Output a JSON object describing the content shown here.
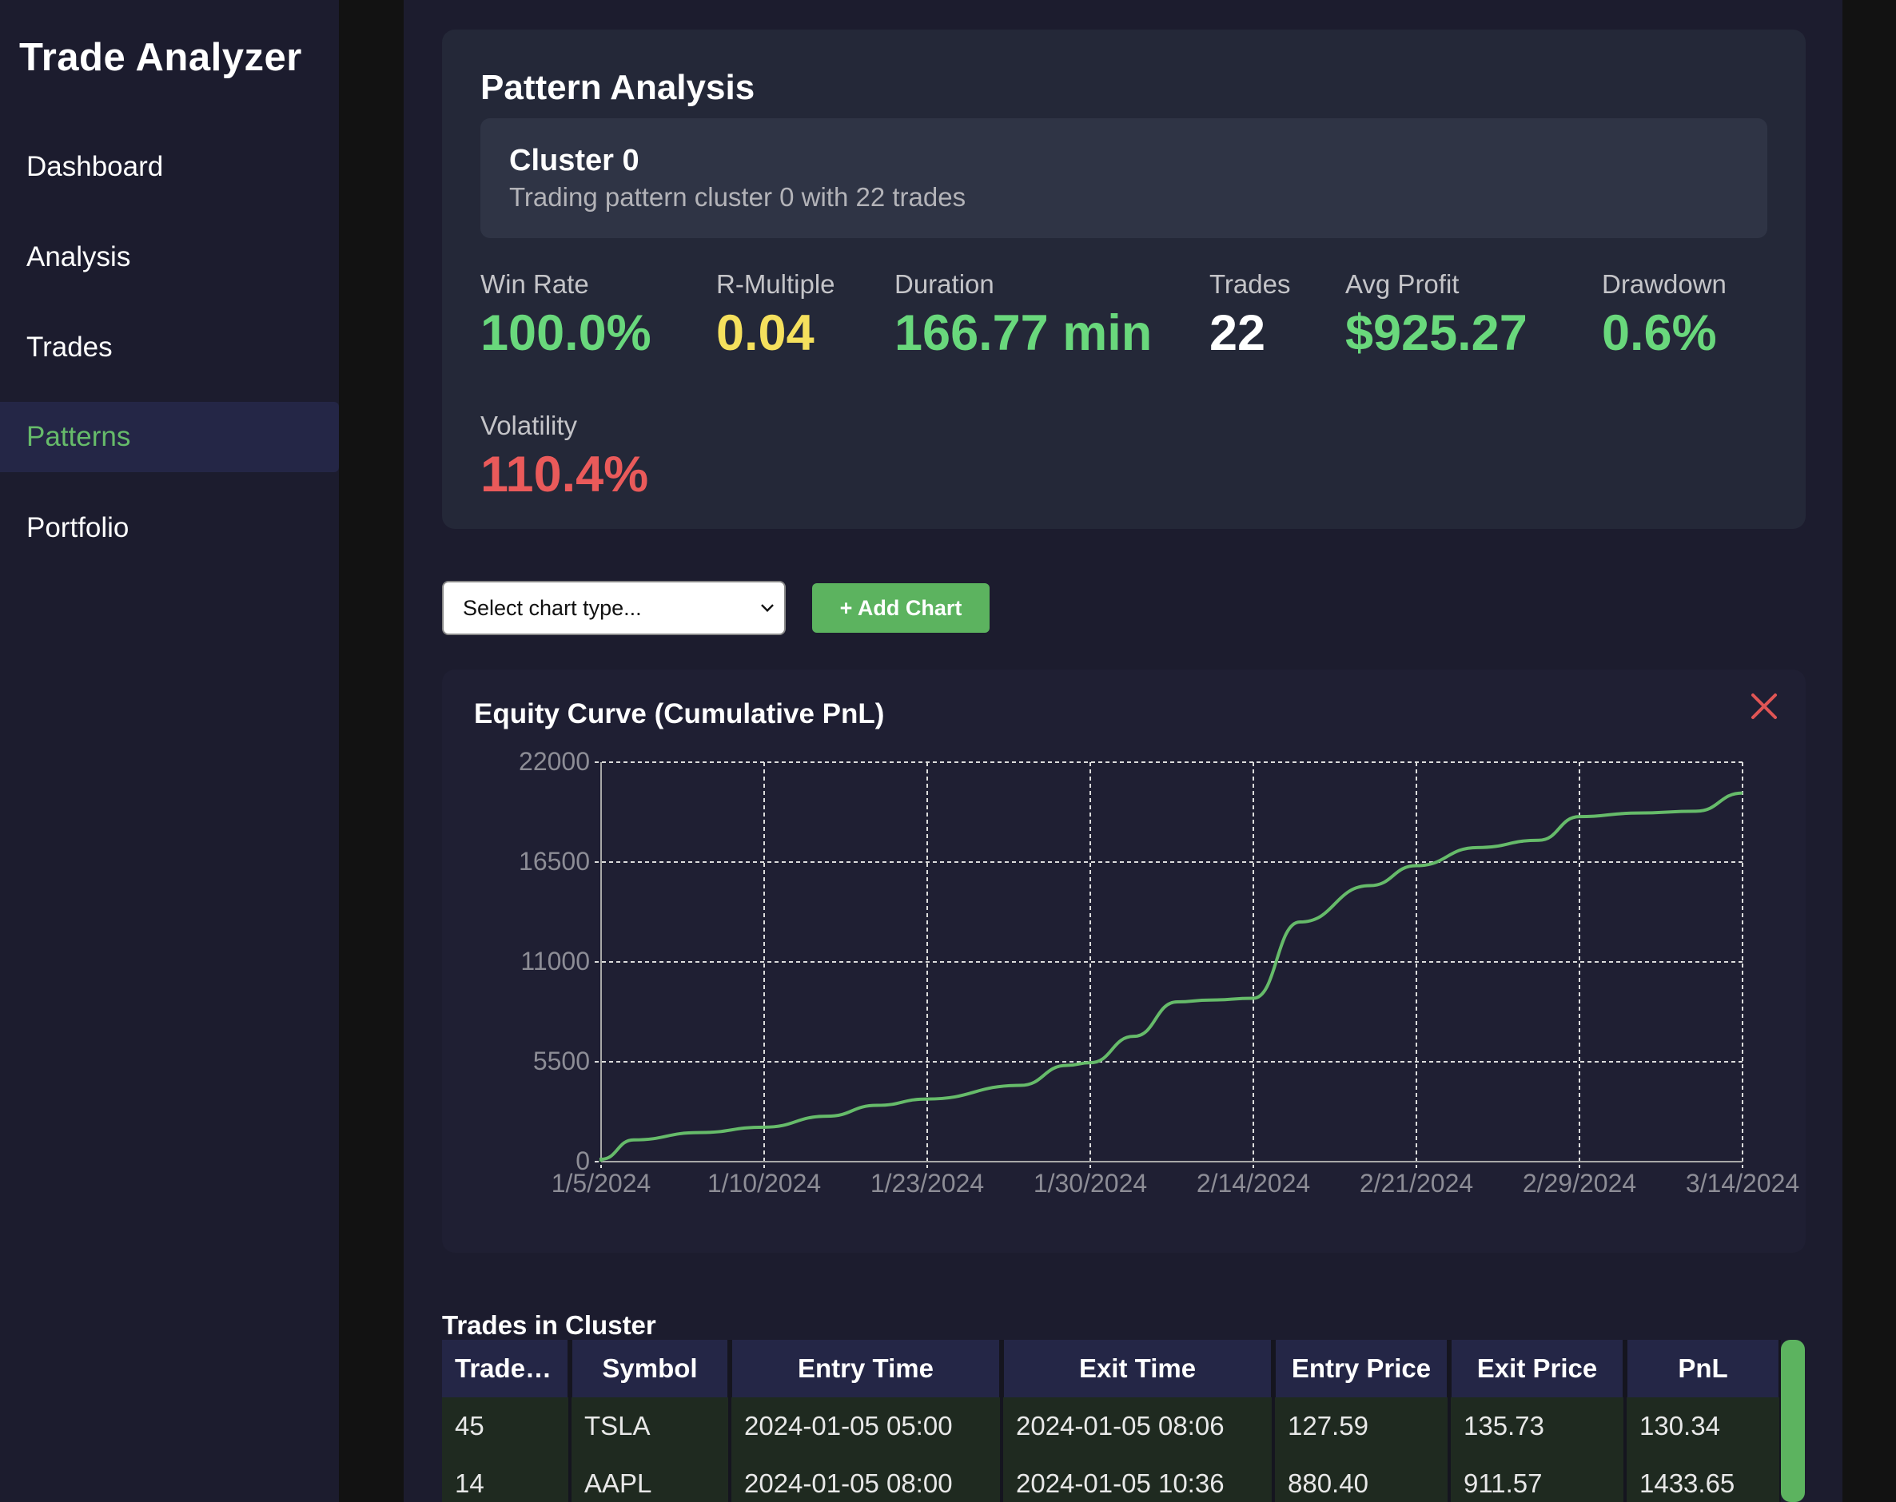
{
  "app": {
    "title": "Trade Analyzer"
  },
  "sidebar": {
    "items": [
      {
        "label": "Dashboard"
      },
      {
        "label": "Analysis"
      },
      {
        "label": "Trades"
      },
      {
        "label": "Patterns",
        "active": true
      },
      {
        "label": "Portfolio"
      }
    ]
  },
  "pattern": {
    "title": "Pattern Analysis",
    "cluster_name": "Cluster 0",
    "cluster_desc": "Trading pattern cluster 0 with 22 trades",
    "metrics": {
      "win_rate_label": "Win Rate",
      "win_rate": "100.0%",
      "r_multiple_label": "R-Multiple",
      "r_multiple": "0.04",
      "duration_label": "Duration",
      "duration": "166.77 min",
      "trades_label": "Trades",
      "trades": "22",
      "avg_profit_label": "Avg Profit",
      "avg_profit": "$925.27",
      "drawdown_label": "Drawdown",
      "drawdown": "0.6%",
      "volatility_label": "Volatility",
      "volatility": "110.4%"
    }
  },
  "controls": {
    "select_value": "Select chart type...",
    "add_chart_label": "+ Add Chart"
  },
  "chart_data": {
    "type": "line",
    "title": "Equity Curve (Cumulative PnL)",
    "xlabel": "",
    "ylabel": "",
    "ylim": [
      0,
      22000
    ],
    "y_ticks": [
      0,
      5500,
      11000,
      16500,
      22000
    ],
    "x_ticks": [
      "1/5/2024",
      "1/10/2024",
      "1/23/2024",
      "1/30/2024",
      "2/14/2024",
      "2/21/2024",
      "2/29/2024",
      "3/14/2024"
    ],
    "grid": true,
    "series": [
      {
        "color": "#66bb6a",
        "points": [
          {
            "x": "1/5/2024",
            "y": 0
          },
          {
            "x": "1/5/2024",
            "y": 130
          },
          {
            "x": "1/6/2024",
            "y": 1200
          },
          {
            "x": "1/8/2024",
            "y": 1600
          },
          {
            "x": "1/10/2024",
            "y": 1900
          },
          {
            "x": "1/15/2024",
            "y": 2500
          },
          {
            "x": "1/19/2024",
            "y": 3100
          },
          {
            "x": "1/23/2024",
            "y": 3450
          },
          {
            "x": "1/27/2024",
            "y": 4200
          },
          {
            "x": "1/29/2024",
            "y": 5300
          },
          {
            "x": "1/30/2024",
            "y": 5450
          },
          {
            "x": "2/3/2024",
            "y": 6900
          },
          {
            "x": "2/7/2024",
            "y": 8800
          },
          {
            "x": "2/10/2024",
            "y": 8900
          },
          {
            "x": "2/14/2024",
            "y": 9000
          },
          {
            "x": "2/16/2024",
            "y": 13200
          },
          {
            "x": "2/19/2024",
            "y": 15200
          },
          {
            "x": "2/21/2024",
            "y": 16300
          },
          {
            "x": "2/24/2024",
            "y": 17300
          },
          {
            "x": "2/27/2024",
            "y": 17700
          },
          {
            "x": "2/29/2024",
            "y": 19000
          },
          {
            "x": "3/5/2024",
            "y": 19200
          },
          {
            "x": "3/10/2024",
            "y": 19300
          },
          {
            "x": "3/14/2024",
            "y": 20300
          }
        ]
      }
    ]
  },
  "table": {
    "title": "Trades in Cluster",
    "columns": [
      "Trade ID",
      "Symbol",
      "Entry Time",
      "Exit Time",
      "Entry Price",
      "Exit Price",
      "PnL"
    ],
    "rows": [
      [
        "45",
        "TSLA",
        "2024-01-05 05:00",
        "2024-01-05 08:06",
        "127.59",
        "135.73",
        "130.34"
      ],
      [
        "14",
        "AAPL",
        "2024-01-05 08:00",
        "2024-01-05 10:36",
        "880.40",
        "911.57",
        "1433.65"
      ]
    ]
  }
}
